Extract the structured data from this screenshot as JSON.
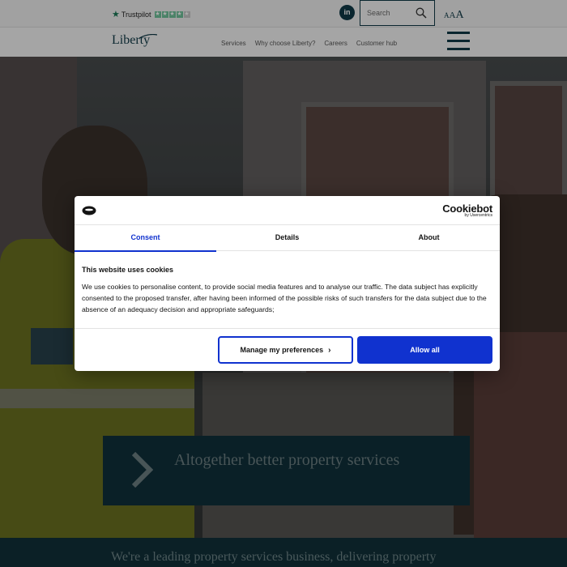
{
  "topbar": {
    "trustpilot_label": "Trustpilot",
    "trustpilot_stars_filled": 4,
    "trustpilot_stars_total": 5,
    "linkedin_label": "in",
    "search_placeholder": "Search",
    "text_size_labels": [
      "A",
      "A",
      "A"
    ]
  },
  "nav": {
    "logo_text": "Liberty",
    "links": [
      "Services",
      "Why choose Liberty?",
      "Careers",
      "Customer hub"
    ],
    "menu_icon": "hamburger-icon"
  },
  "hero": {
    "promo_text": "Altogether better property services",
    "promo_icon": "chevron-right-icon"
  },
  "intro_text": "We're a leading property services business, delivering property",
  "cookie_dialog": {
    "brand_logo": "Cookiebot",
    "brand_sub": "by Usercentrics",
    "tabs": [
      "Consent",
      "Details",
      "About"
    ],
    "active_tab": "Consent",
    "title": "This website uses cookies",
    "body": "We use cookies to personalise content, to provide social media features and to analyse our traffic. The data subject has explicitly consented to the proposed transfer, after having been informed of the possible risks of such transfers for the data subject due to the absence of an adequacy decision and appropriate safeguards;",
    "manage_label": "Manage my preferences",
    "allow_label": "Allow all"
  },
  "colors": {
    "accent_blue": "#1032cf",
    "brand_navy": "#0f3a47",
    "promo_bg": "#10303b"
  }
}
